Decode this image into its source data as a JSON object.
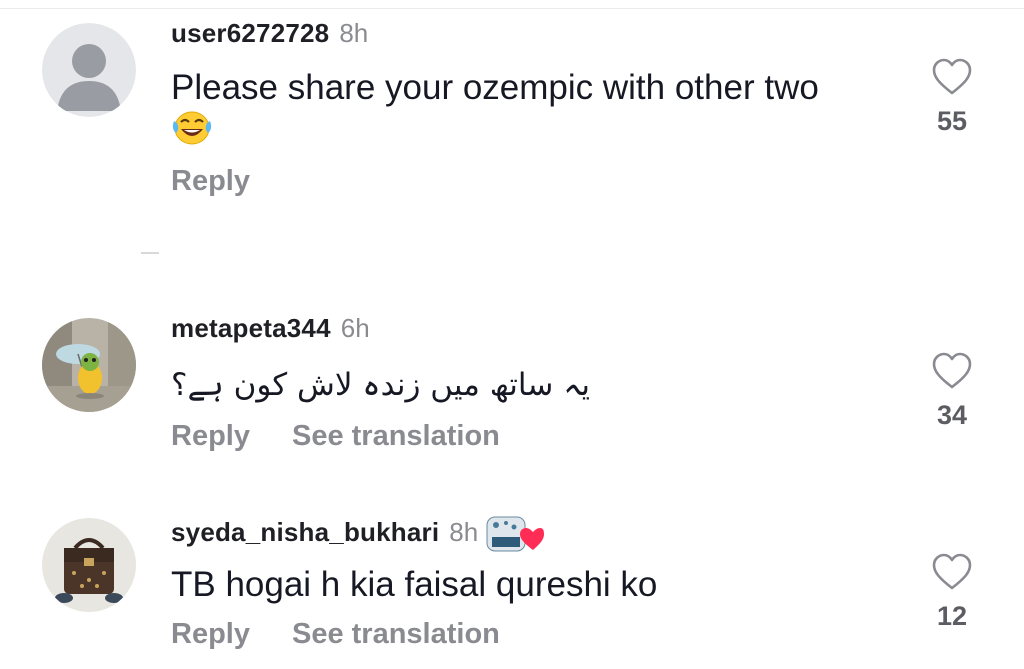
{
  "comments": [
    {
      "username": "user6272728",
      "time": "8h",
      "text": "Please share your ozempic with other two",
      "emoji": "😂",
      "reply_label": "Reply",
      "likes": "55"
    },
    {
      "username": "metapeta344",
      "time": "6h",
      "text": "یہ ساتھ میں زندہ لاش کون ہے؟",
      "reply_label": "Reply",
      "translate_label": "See translation",
      "likes": "34"
    },
    {
      "username": "syeda_nisha_bukhari",
      "time": "8h",
      "text": "TB hogai h kia faisal qureshi ko",
      "reply_label": "Reply",
      "translate_label": "See translation",
      "likes": "12"
    }
  ],
  "icons": {
    "like": "heart-outline-icon",
    "default_avatar": "person-icon",
    "badge_heart_color": "#ff2d55"
  }
}
